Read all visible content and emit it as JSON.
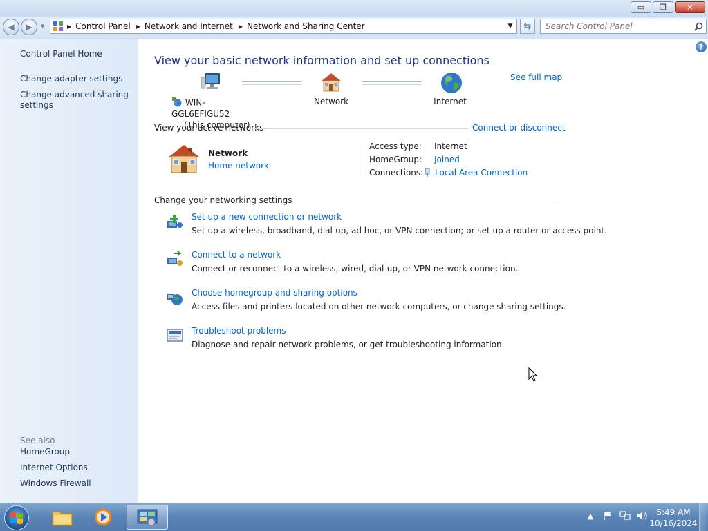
{
  "window": {
    "buttons": {
      "minimize": "▭",
      "maximize": "❐",
      "close": "✕"
    }
  },
  "navbar": {
    "breadcrumbs": [
      "Control Panel",
      "Network and Internet",
      "Network and Sharing Center"
    ],
    "search_placeholder": "Search Control Panel"
  },
  "sidebar": {
    "home": "Control Panel Home",
    "items": [
      "Change adapter settings",
      "Change advanced sharing settings"
    ],
    "see_also_header": "See also",
    "see_also": [
      "HomeGroup",
      "Internet Options",
      "Windows Firewall"
    ]
  },
  "main": {
    "title": "View your basic network information and set up connections",
    "see_full_map": "See full map",
    "map": {
      "computer_name": "WIN-GGL6EFIGU52",
      "computer_sub": "(This computer)",
      "network": "Network",
      "internet": "Internet"
    },
    "active_networks": {
      "header": "View your active networks",
      "connect_link": "Connect or disconnect",
      "network_name": "Network",
      "network_type": "Home network",
      "access_type_label": "Access type:",
      "access_type_value": "Internet",
      "homegroup_label": "HomeGroup:",
      "homegroup_value": "Joined",
      "connections_label": "Connections:",
      "connections_value": "Local Area Connection"
    },
    "settings": {
      "header": "Change your networking settings",
      "tasks": [
        {
          "title": "Set up a new connection or network",
          "desc": "Set up a wireless, broadband, dial-up, ad hoc, or VPN connection; or set up a router or access point."
        },
        {
          "title": "Connect to a network",
          "desc": "Connect or reconnect to a wireless, wired, dial-up, or VPN network connection."
        },
        {
          "title": "Choose homegroup and sharing options",
          "desc": "Access files and printers located on other network computers, or change sharing settings."
        },
        {
          "title": "Troubleshoot problems",
          "desc": "Diagnose and repair network problems, or get troubleshooting information."
        }
      ]
    }
  },
  "taskbar": {
    "time": "5:49 AM",
    "date": "10/16/2024"
  },
  "colors": {
    "link": "#0066cc",
    "heading": "#1e3287",
    "sidebar_bg": "#e3edf9"
  }
}
